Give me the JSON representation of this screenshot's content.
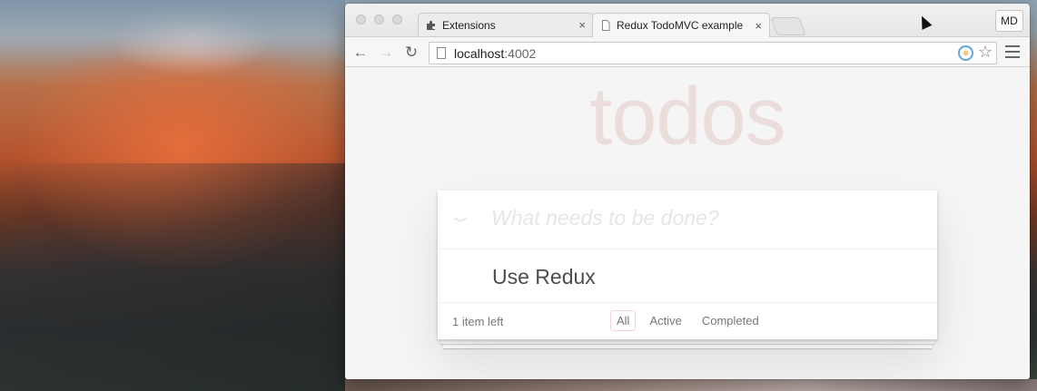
{
  "browser": {
    "tabs": [
      {
        "label": "Extensions",
        "icon": "puzzle-icon",
        "active": false
      },
      {
        "label": "Redux TodoMVC example",
        "icon": "page-icon",
        "active": true
      }
    ],
    "tab_close_glyph": "×",
    "profile_label": "MD",
    "address": {
      "host": "localhost",
      "port": ":4002"
    }
  },
  "app": {
    "title": "todos",
    "new_todo_placeholder": "What needs to be done?",
    "todos": [
      {
        "text": "Use Redux",
        "completed": false
      }
    ],
    "footer": {
      "count_text": "1 item left",
      "filters": [
        "All",
        "Active",
        "Completed"
      ],
      "selected_filter": "All"
    }
  },
  "colors": {
    "title": "#af2f2f",
    "text": "#4d4d4d",
    "muted": "#777777"
  }
}
